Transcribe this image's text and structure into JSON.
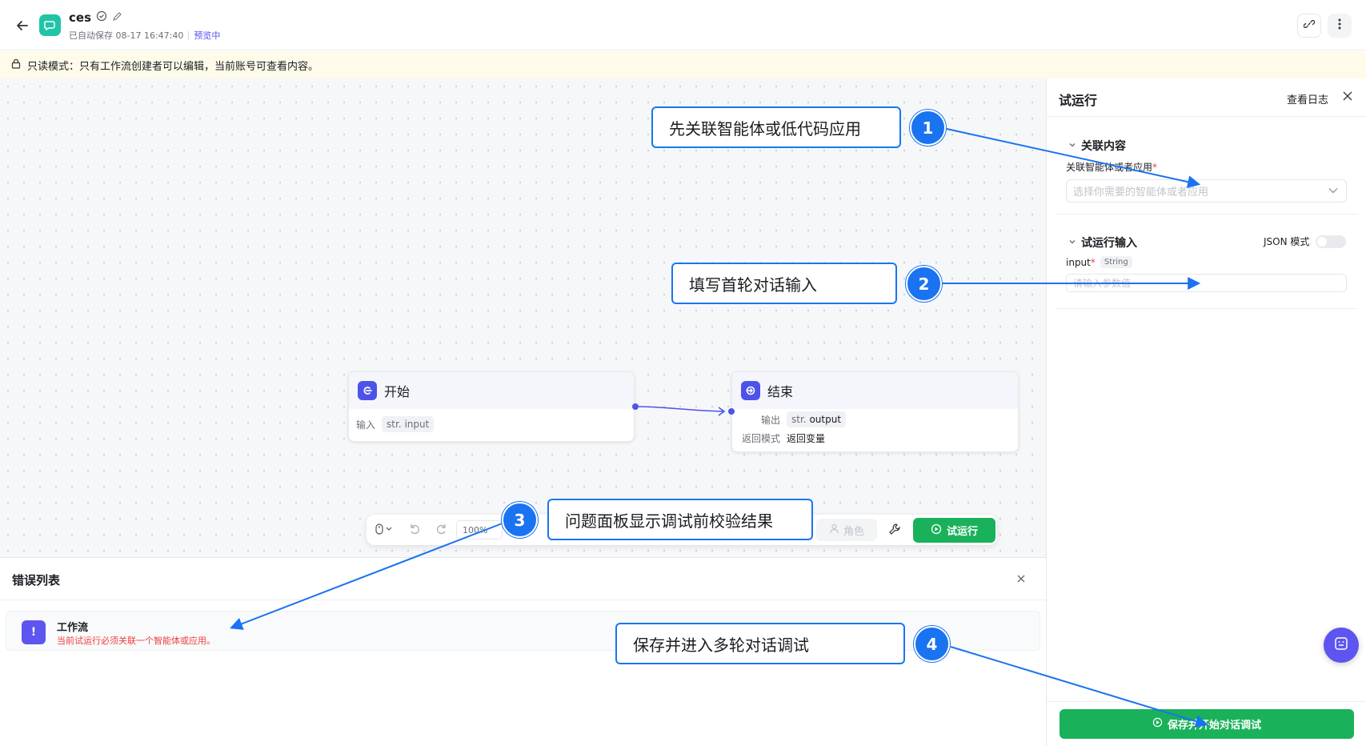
{
  "header": {
    "title": "ces",
    "autosave": "已自动保存 08-17 16:47:40",
    "preview": "预览中"
  },
  "banner": {
    "text": "只读模式：只有工作流创建者可以编辑，当前账号可查看内容。"
  },
  "nodes": {
    "start": {
      "title": "开始",
      "input_label": "输入",
      "input_type": "str.",
      "input_name": "input"
    },
    "end": {
      "title": "结束",
      "output_label": "输出",
      "output_type": "str.",
      "output_name": "output",
      "return_mode_label": "返回模式",
      "return_mode_value": "返回变量"
    }
  },
  "toolbar": {
    "zoom": "100%",
    "role": "角色",
    "run": "试运行"
  },
  "error_panel": {
    "title": "错误列表",
    "items": [
      {
        "badge": "!",
        "title": "工作流",
        "message": "当前试运行必须关联一个智能体或应用。"
      }
    ]
  },
  "side_panel": {
    "title": "试运行",
    "log": "查看日志",
    "section1": "关联内容",
    "assoc_label": "关联智能体或者应用",
    "assoc_placeholder": "选择你需要的智能体或者应用",
    "section2": "试运行输入",
    "json_mode": "JSON 模式",
    "input_name": "input",
    "input_type": "String",
    "input_placeholder": "请输入参数值",
    "save_button": "保存并开始对话调试"
  },
  "callouts": [
    {
      "num": "1",
      "text": "先关联智能体或低代码应用"
    },
    {
      "num": "2",
      "text": "填写首轮对话输入"
    },
    {
      "num": "3",
      "text": "问题面板显示调试前校验结果"
    },
    {
      "num": "4",
      "text": "保存并进入多轮对话调试"
    }
  ],
  "colors": {
    "accent": "#4d53e8",
    "run_green": "#1ab15b",
    "callout_blue": "#1a73f0",
    "error_red": "#f03e3e"
  }
}
